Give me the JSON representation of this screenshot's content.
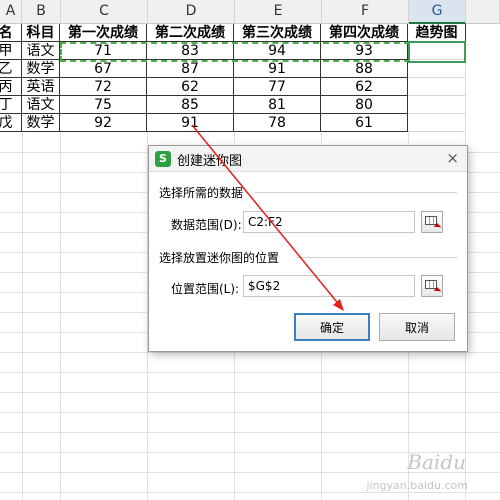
{
  "columns": {
    "labels": [
      "A",
      "B",
      "C",
      "D",
      "E",
      "F",
      "G"
    ],
    "selected": "G"
  },
  "table": {
    "headers": [
      "名",
      "科目",
      "第一次成绩",
      "第二次成绩",
      "第三次成绩",
      "第四次成绩",
      "趋势图"
    ],
    "rows": [
      [
        "甲",
        "语文",
        "71",
        "83",
        "94",
        "93",
        ""
      ],
      [
        "乙",
        "数学",
        "67",
        "87",
        "91",
        "88",
        ""
      ],
      [
        "丙",
        "英语",
        "72",
        "62",
        "77",
        "62",
        ""
      ],
      [
        "丁",
        "语文",
        "75",
        "85",
        "81",
        "80",
        ""
      ],
      [
        "戊",
        "数学",
        "92",
        "91",
        "78",
        "61",
        ""
      ]
    ]
  },
  "dialog": {
    "title": "创建迷你图",
    "logo": "S",
    "close_icon": "×",
    "section_data": "选择所需的数据",
    "data_range_label": "数据范围(D):",
    "data_range_value": "C2:F2",
    "section_location": "选择放置迷你图的位置",
    "location_label": "位置范围(L):",
    "location_value": "$G$2",
    "ok_label": "确定",
    "cancel_label": "取消"
  },
  "watermark": {
    "brand": "Baidu",
    "sub": "jingyan.baidu.com"
  },
  "colors": {
    "accent_green": "#2ea043",
    "selection_green": "#3e9c5a",
    "annotation_red": "#e0201b",
    "primary_button_border": "#3c7fc1"
  }
}
